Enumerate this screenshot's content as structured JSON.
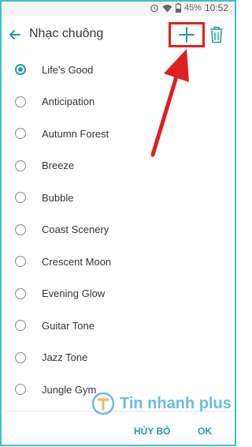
{
  "status_bar": {
    "battery": "45%",
    "time": "10:52"
  },
  "app_bar": {
    "title": "Nhạc chuông"
  },
  "ringtones": [
    {
      "label": "Life's Good",
      "selected": true
    },
    {
      "label": "Anticipation",
      "selected": false
    },
    {
      "label": "Autumn Forest",
      "selected": false
    },
    {
      "label": "Breeze",
      "selected": false
    },
    {
      "label": "Bubble",
      "selected": false
    },
    {
      "label": "Coast Scenery",
      "selected": false
    },
    {
      "label": "Crescent Moon",
      "selected": false
    },
    {
      "label": "Evening Glow",
      "selected": false
    },
    {
      "label": "Guitar Tone",
      "selected": false
    },
    {
      "label": "Jazz Tone",
      "selected": false
    },
    {
      "label": "Jungle Gym",
      "selected": false
    }
  ],
  "bottom_bar": {
    "cancel_label": "HỦY BỎ",
    "ok_label": "OK"
  },
  "watermark": {
    "text": "Tin nhanh plus"
  },
  "icons": {
    "back": "back-arrow-icon",
    "add": "plus-icon",
    "delete": "trash-icon",
    "wifi": "wifi-icon",
    "battery": "battery-icon",
    "alarm": "alarm-clock-icon"
  },
  "colors": {
    "accent": "#1f9aaa",
    "highlight": "#e02020",
    "frame": "#3fc0cc",
    "watermark": "#3aa6d8"
  }
}
